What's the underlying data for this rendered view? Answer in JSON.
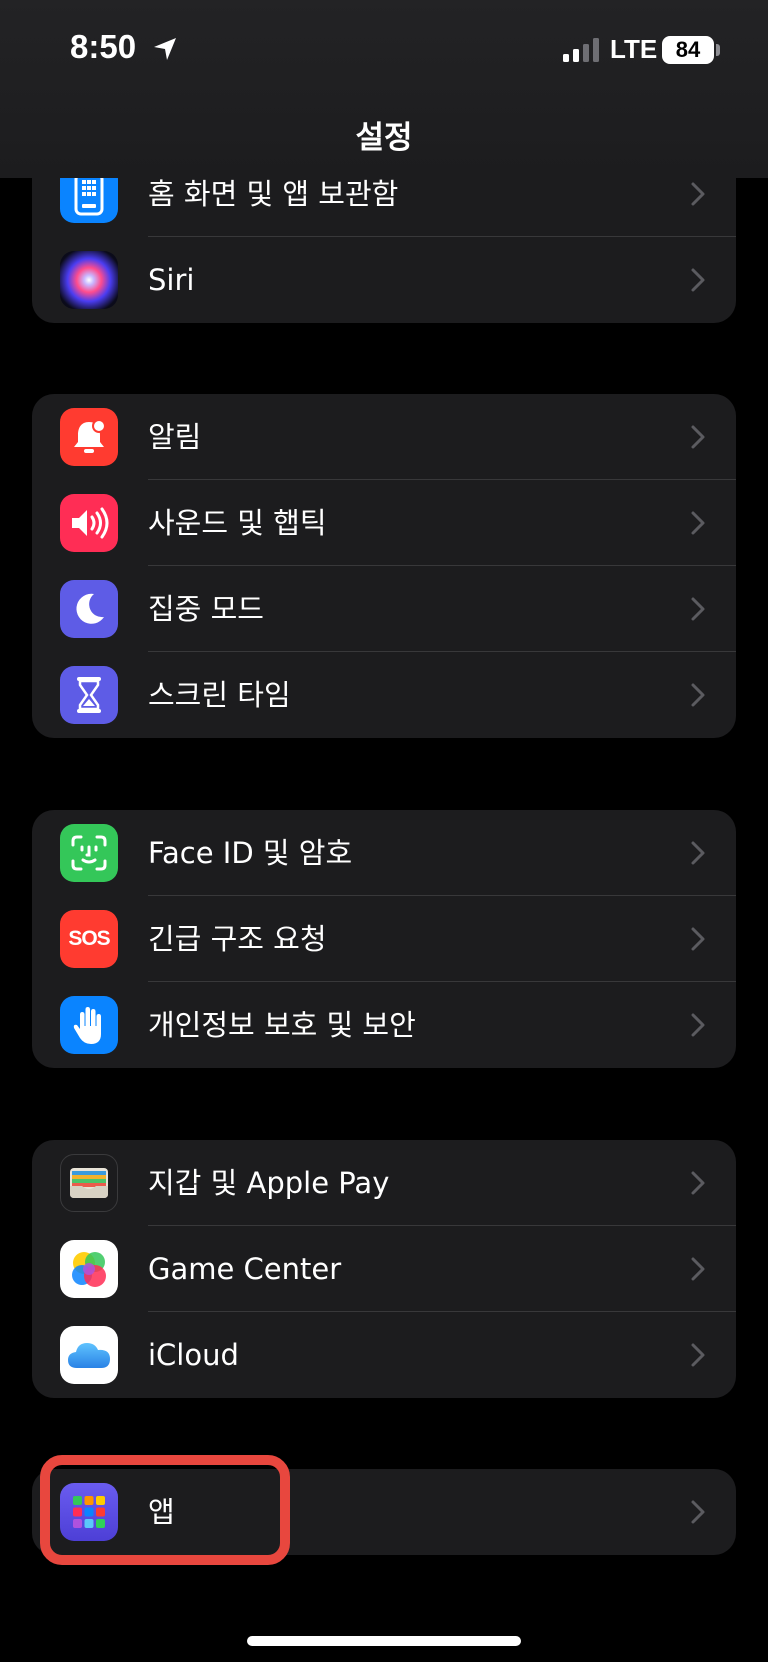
{
  "status_bar": {
    "time": "8:50",
    "network": "LTE",
    "battery": "84"
  },
  "nav": {
    "title": "설정"
  },
  "groups": [
    {
      "items": [
        {
          "label": "홈 화면 및 앱 보관함",
          "icon": "home-screen-icon",
          "color": "#0a84ff"
        },
        {
          "label": "Siri",
          "icon": "siri-icon",
          "color": "#1a1a2e"
        }
      ]
    },
    {
      "items": [
        {
          "label": "알림",
          "icon": "bell-icon",
          "color": "#ff3b30"
        },
        {
          "label": "사운드 및 햅틱",
          "icon": "speaker-icon",
          "color": "#ff2d55"
        },
        {
          "label": "집중 모드",
          "icon": "moon-icon",
          "color": "#5e5ce6"
        },
        {
          "label": "스크린 타임",
          "icon": "hourglass-icon",
          "color": "#5e5ce6"
        }
      ]
    },
    {
      "items": [
        {
          "label": "Face ID 및 암호",
          "icon": "face-id-icon",
          "color": "#34c759"
        },
        {
          "label": "긴급 구조 요청",
          "icon": "sos-icon",
          "color": "#ff3b30",
          "badge": "SOS"
        },
        {
          "label": "개인정보 보호 및 보안",
          "icon": "hand-icon",
          "color": "#0a84ff"
        }
      ]
    },
    {
      "items": [
        {
          "label": "지갑 및 Apple Pay",
          "icon": "wallet-icon",
          "color": "#1c1c1e"
        },
        {
          "label": "Game Center",
          "icon": "game-center-icon",
          "color": "#ffffff"
        },
        {
          "label": "iCloud",
          "icon": "icloud-icon",
          "color": "#ffffff"
        }
      ]
    },
    {
      "items": [
        {
          "label": "앱",
          "icon": "apps-icon",
          "color": "#5e5ce6"
        }
      ]
    }
  ],
  "highlight_color": "#e8473e"
}
